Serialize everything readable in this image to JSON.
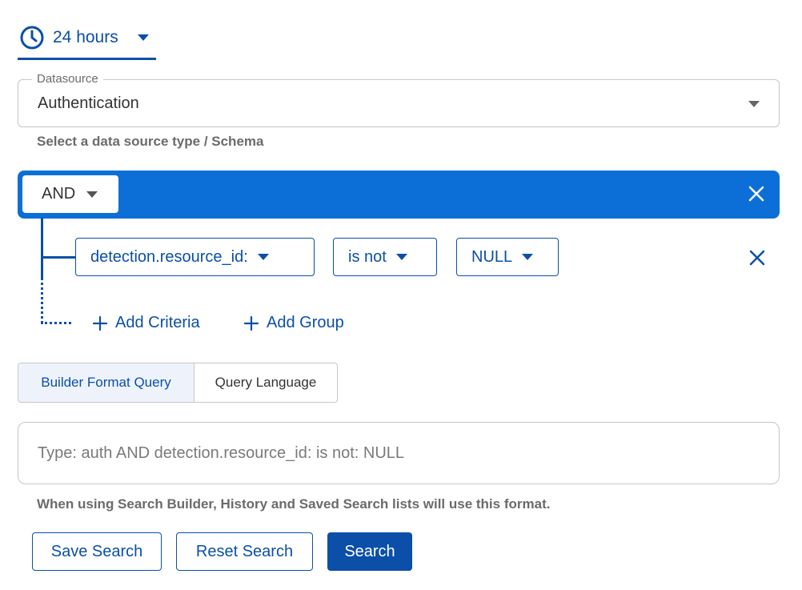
{
  "time_range": {
    "label": "24 hours",
    "icon": "clock-icon"
  },
  "datasource": {
    "legend": "Datasource",
    "value": "Authentication",
    "helper": "Select a data source type / Schema"
  },
  "group": {
    "operator": "AND"
  },
  "criteria": {
    "field": "detection.resource_id:",
    "operator": "is not",
    "value": "NULL"
  },
  "actions": {
    "add_criteria": "Add Criteria",
    "add_group": "Add Group"
  },
  "tabs": [
    {
      "label": "Builder Format Query",
      "active": true
    },
    {
      "label": "Query Language",
      "active": false
    }
  ],
  "query": {
    "placeholder": "Type: auth AND detection.resource_id: is not: NULL",
    "helper": "When using Search Builder, History and Saved Search lists will use this format."
  },
  "buttons": {
    "save": "Save Search",
    "reset": "Reset Search",
    "search": "Search"
  },
  "colors": {
    "primary": "#0b4fa8",
    "group_bar": "#0c6fd8",
    "active_tab_bg": "#eef3fb"
  }
}
